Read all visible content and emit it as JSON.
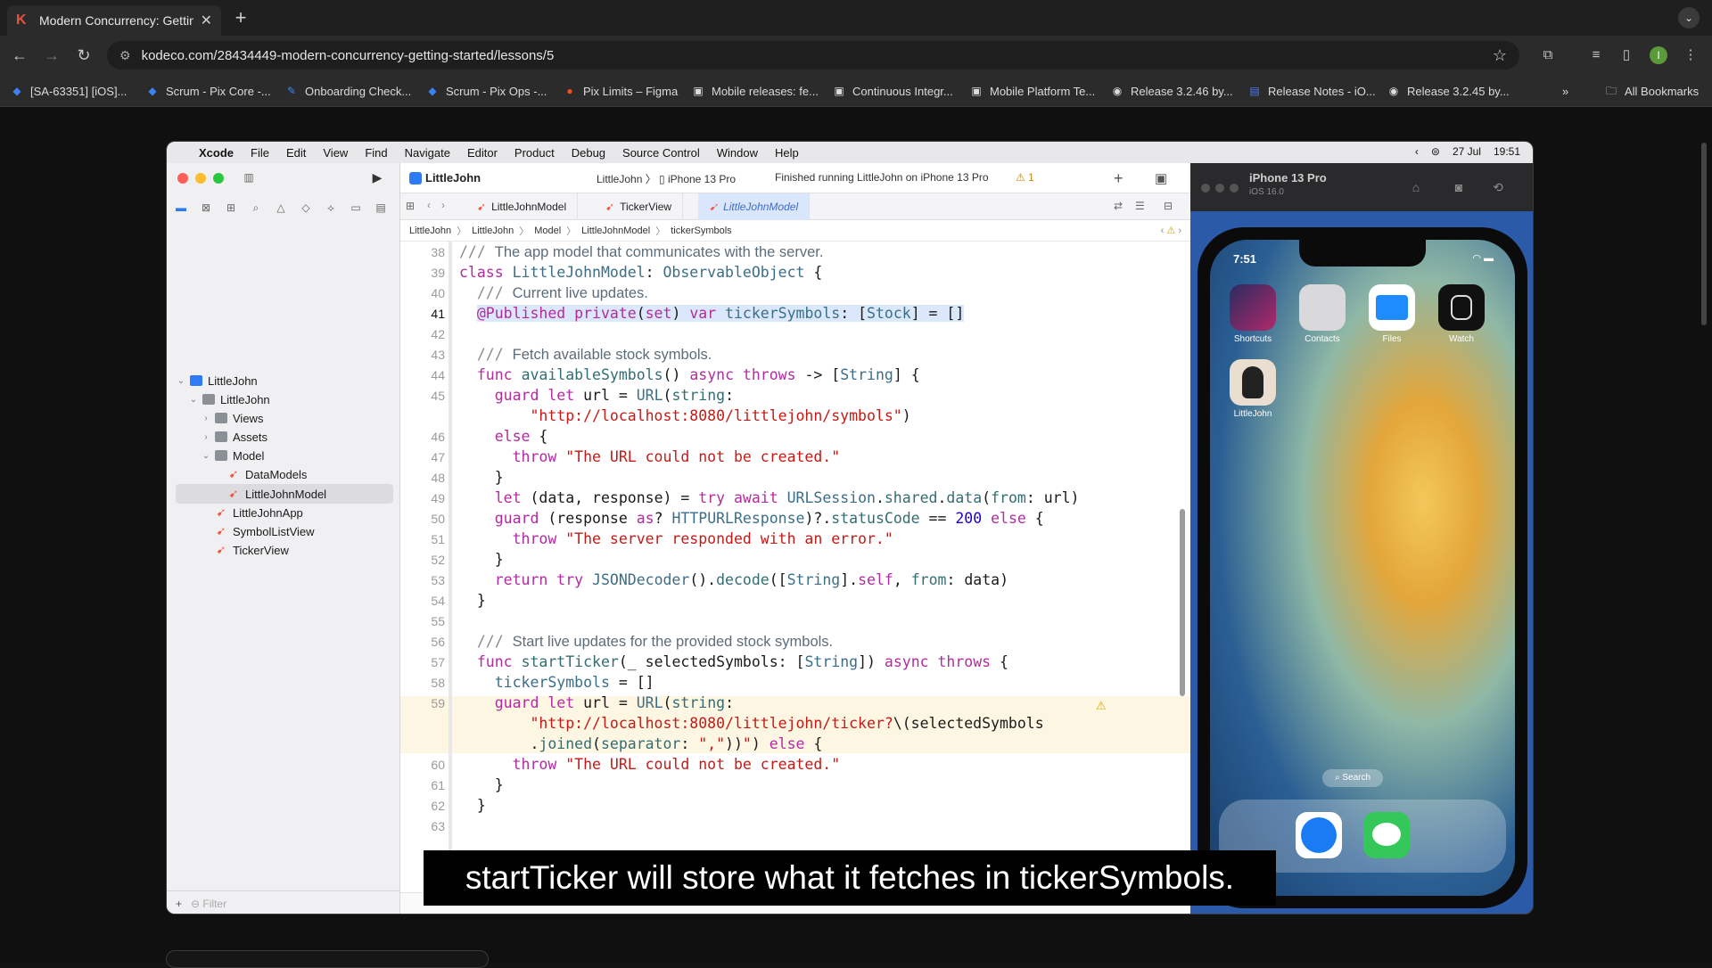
{
  "browser": {
    "tab_title": "Modern Concurrency: Getting",
    "url": "kodeco.com/28434449-modern-concurrency-getting-started/lessons/5",
    "bookmarks": [
      "[SA-63351] [iOS]...",
      "Scrum - Pix Core -...",
      "Onboarding Check...",
      "Scrum - Pix Ops -...",
      "Pix Limits – Figma",
      "Mobile releases: fe...",
      "Continuous Integr...",
      "Mobile Platform Te...",
      "Release 3.2.46 by...",
      "Release Notes - iO...",
      "Release 3.2.45 by..."
    ],
    "all_bookmarks": "All Bookmarks",
    "profile_initial": "I"
  },
  "mac": {
    "menu": [
      "Xcode",
      "File",
      "Edit",
      "View",
      "Find",
      "Navigate",
      "Editor",
      "Product",
      "Debug",
      "Source Control",
      "Window",
      "Help"
    ],
    "date": "27 Jul",
    "time": "19:51"
  },
  "xcode": {
    "project": "LittleJohn",
    "scheme": "LittleJohn",
    "device": "iPhone 13 Pro",
    "status": "Finished running LittleJohn on iPhone 13 Pro",
    "warning_count": "1",
    "tabs": [
      "LittleJohnModel",
      "TickerView",
      "LittleJohnModel"
    ],
    "jumpbar": [
      "LittleJohn",
      "LittleJohn",
      "Model",
      "LittleJohnModel",
      "tickerSymbols"
    ],
    "navigator": [
      "LittleJohn",
      "LittleJohn",
      "Views",
      "Assets",
      "Model",
      "DataModels",
      "LittleJohnModel",
      "LittleJohnApp",
      "SymbolListView",
      "TickerView"
    ],
    "filter_placeholder": "Filter"
  },
  "code": {
    "line_numbers": [
      "38",
      "39",
      "40",
      "41",
      "42",
      "43",
      "44",
      "45",
      "",
      "46",
      "47",
      "48",
      "49",
      "50",
      "51",
      "52",
      "53",
      "54",
      "55",
      "56",
      "57",
      "58",
      "59",
      "",
      "",
      "60",
      "61",
      "62",
      "63"
    ]
  },
  "simulator": {
    "device": "iPhone 13 Pro",
    "ios": "iOS 16.0",
    "time": "7:51",
    "apps": [
      "Shortcuts",
      "Contacts",
      "Files",
      "Watch",
      "LittleJohn"
    ],
    "search": "Search"
  },
  "subtitle": "startTicker will store what it fetches in tickerSymbols.",
  "colors": {
    "xcode_keyword": "#b22ba0",
    "xcode_string": "#c41a16",
    "xcode_type": "#3b6e88",
    "selection": "#dbe7fa"
  }
}
